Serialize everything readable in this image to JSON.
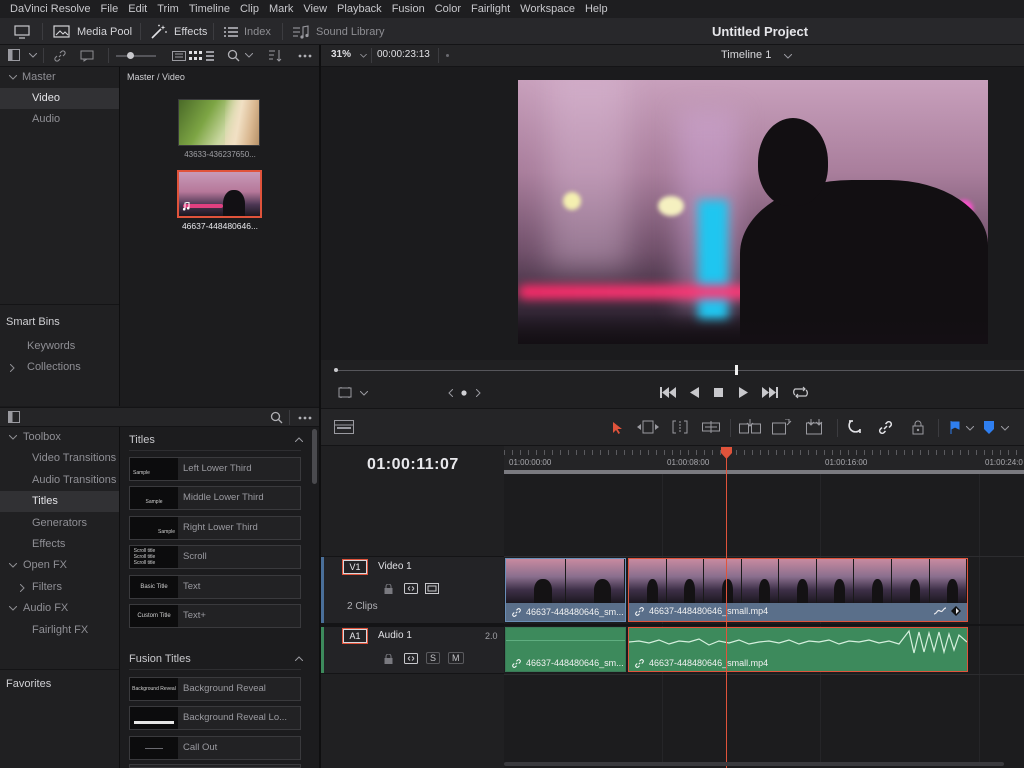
{
  "menu": [
    "DaVinci Resolve",
    "File",
    "Edit",
    "Trim",
    "Timeline",
    "Clip",
    "Mark",
    "View",
    "Playback",
    "Fusion",
    "Color",
    "Fairlight",
    "Workspace",
    "Help"
  ],
  "toolbar": {
    "media_pool": "Media Pool",
    "effects": "Effects",
    "index": "Index",
    "sound_library": "Sound Library",
    "project_title": "Untitled Project"
  },
  "viewer": {
    "zoom": "31%",
    "timecode": "00:00:23:13",
    "timeline_name": "Timeline 1"
  },
  "bins": {
    "master": "Master",
    "items": [
      "Video",
      "Audio"
    ],
    "smart_bins": "Smart Bins",
    "smart_items": [
      "Keywords",
      "Collections"
    ]
  },
  "clips": {
    "path": "Master / Video",
    "items": [
      "43633-436237650...",
      "46637-448480646..."
    ]
  },
  "effects_tree": {
    "toolbox": "Toolbox",
    "toolbox_items": [
      "Video Transitions",
      "Audio Transitions",
      "Titles",
      "Generators",
      "Effects"
    ],
    "open_fx": "Open FX",
    "filters": "Filters",
    "audio_fx": "Audio FX",
    "fairlight_fx": "Fairlight FX",
    "favorites": "Favorites"
  },
  "effects_list": {
    "titles_header": "Titles",
    "titles": [
      {
        "thumb": "Sample",
        "label": "Left Lower Third"
      },
      {
        "thumb": "Sample",
        "label": "Middle Lower Third"
      },
      {
        "thumb": "Sample",
        "label": "Right Lower Third"
      },
      {
        "thumb": "Scroll title Scroll title Scroll title",
        "label": "Scroll"
      },
      {
        "thumb": "Basic Title",
        "label": "Text"
      },
      {
        "thumb": "Custom Title",
        "label": "Text+"
      }
    ],
    "fusion_header": "Fusion Titles",
    "fusion": [
      {
        "thumb": "Background Reveal",
        "label": "Background Reveal"
      },
      {
        "thumb": "",
        "label": "Background Reveal Lo..."
      },
      {
        "thumb": "",
        "label": "Call Out"
      }
    ]
  },
  "timeline": {
    "current_timecode": "01:00:11:07",
    "ruler": [
      "01:00:00:00",
      "01:00:08:00",
      "01:00:16:00",
      "01:00:24:0"
    ],
    "video_track": {
      "id": "V1",
      "name": "Video 1",
      "clips_count": "2 Clips"
    },
    "audio_track": {
      "id": "A1",
      "name": "Audio 1",
      "channels": "2.0",
      "solo": "S",
      "mute": "M"
    },
    "clip1_name": "46637-448480646_sm...",
    "clip2_name": "46637-448480646_small.mp4",
    "accent": "#e0533b",
    "video_clip_color": "#5a6f8a",
    "audio_clip_color": "#3d8a5c"
  }
}
